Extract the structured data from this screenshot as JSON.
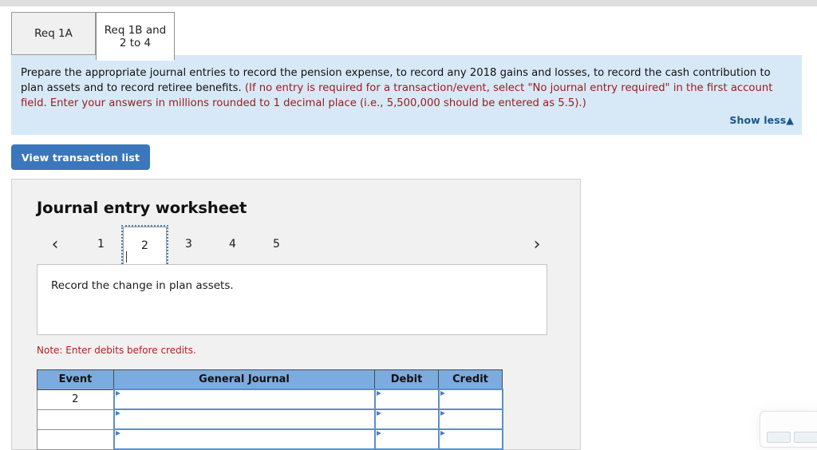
{
  "tabs": [
    {
      "label": "Req 1A",
      "active": false
    },
    {
      "label": "Req 1B and 2 to 4",
      "active": true
    }
  ],
  "banner": {
    "text_black_1": "Prepare the appropriate journal entries to record the pension expense, to record any 2018 gains and losses, to record the cash contribution to plan assets and to record retiree benefits. ",
    "text_red": "(If no entry is required for a transaction/event, select \"No journal entry required\" in the first account field. Enter your answers in millions rounded to 1 decimal place (i.e., 5,500,000 should be entered as 5.5).)",
    "show_less_label": "Show less",
    "show_less_caret": "▲",
    "background_color": "#d7e9f7",
    "red_color": "#9c1a1a",
    "link_color": "#17558c"
  },
  "toolbar": {
    "view_transaction_list_label": "View transaction list",
    "button_color": "#3c77bd"
  },
  "worksheet": {
    "title": "Journal entry worksheet",
    "pager": {
      "prev_glyph": "‹",
      "next_glyph": "›",
      "pages": [
        "1",
        "2",
        "3",
        "4",
        "5"
      ],
      "selected_page": "2"
    },
    "description": "Record the change in plan assets.",
    "note": "Note: Enter debits before credits.",
    "table": {
      "headers": [
        "Event",
        "General Journal",
        "Debit",
        "Credit"
      ],
      "header_color": "#7cabdf",
      "rows": [
        {
          "event": "2",
          "general_journal": "",
          "debit": "",
          "credit": ""
        },
        {
          "event": "",
          "general_journal": "",
          "debit": "",
          "credit": ""
        },
        {
          "event": "",
          "general_journal": "",
          "debit": "",
          "credit": ""
        }
      ]
    }
  }
}
